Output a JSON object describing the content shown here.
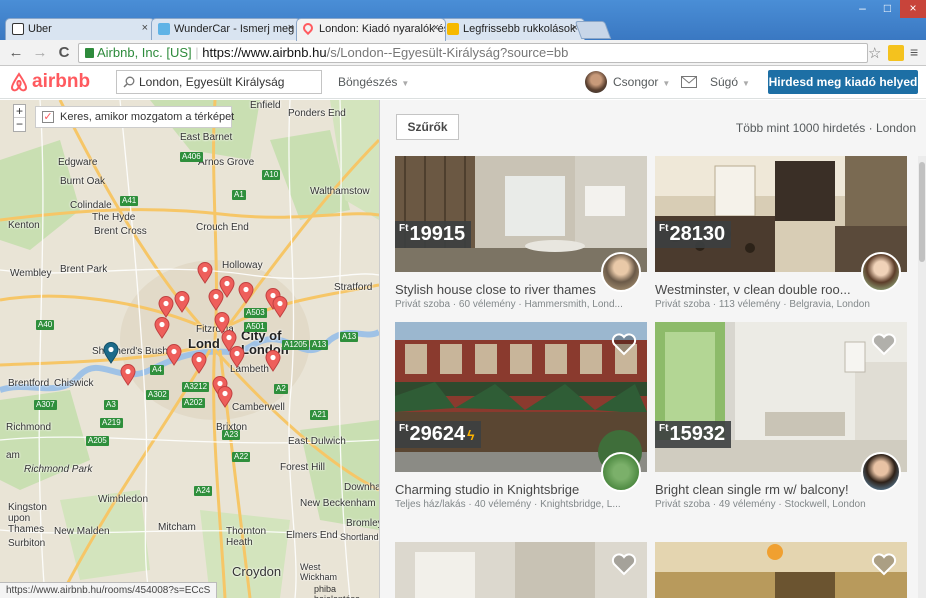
{
  "browser": {
    "tabs": [
      {
        "label": "Uber"
      },
      {
        "label": "WunderCar - Ismerj meg ú"
      },
      {
        "label": "London: Kiadó nyaralók és"
      },
      {
        "label": "Legfrissebb rukkolások | r"
      }
    ],
    "ev_label": "Airbnb, Inc. [US]",
    "url_host": "https://www.airbnb.hu",
    "url_rest": "/s/London--Egyesült-Királyság?source=bb",
    "status_url": "https://www.airbnb.hu/rooms/454008?s=ECcS",
    "icons": [
      "back-icon",
      "forward-icon",
      "reload-icon",
      "lock-icon",
      "star-icon",
      "menu-icon"
    ]
  },
  "header": {
    "logo_text": "airbnb",
    "search_value": "London, Egyesült Királyság",
    "browse_label": "Böngészés",
    "user_name": "Csongor",
    "help_label": "Súgó",
    "host_button": "Hirdesd meg kiadó helyed",
    "brand_color": "#ff5a5f",
    "button_color": "#1d6fa5"
  },
  "map": {
    "checkbox_label": "Keres, amikor mozgatom a térképet",
    "checkbox_checked": true,
    "zoom_in": "+",
    "zoom_out": "−",
    "data_label": "phiba bejelentése",
    "places": [
      "Enfield",
      "Ponders End",
      "East Barnet",
      "Edgware",
      "Burnt Oak",
      "Arnos Grove",
      "Colindale",
      "The Hyde",
      "Walthamstow",
      "Kenton",
      "Brent Cross",
      "Crouch End",
      "Wembley",
      "Brent Park",
      "Holloway",
      "Stratford",
      "City of",
      "London",
      "Fitzrovia",
      "Shepherd's Bush",
      "Chiswick",
      "Lambeth",
      "Camberwell",
      "Brentford",
      "Richmond",
      "Richmond Park",
      "Brixton",
      "East Dulwich",
      "Forest Hill",
      "Wimbledon",
      "Downham",
      "New Beckenham",
      "Kingston upon Thames",
      "New Malden",
      "Mitcham",
      "Thornton Heath",
      "Elmers End",
      "Bromley",
      "Shortlands",
      "Surbiton",
      "Croydon",
      "West Wickham",
      "Lond",
      "am"
    ],
    "roads": [
      "A406",
      "A41",
      "A1",
      "A10",
      "A503",
      "A501",
      "A40",
      "A4",
      "A3",
      "A23",
      "A205",
      "A22",
      "A24",
      "A21",
      "A13",
      "A13",
      "A307",
      "A2",
      "A302",
      "A3212",
      "A202",
      "A219",
      "A1205"
    ]
  },
  "listings_header": {
    "filters_label": "Szűrők",
    "count_label": "Több mint 1000 hirdetés · London"
  },
  "listings": [
    {
      "currency": "Ft",
      "price": "19915",
      "instant": false,
      "title": "Stylish house close to river thames",
      "subtitle": "Privát szoba · 60 vélemény · Hammersmith, Lond..."
    },
    {
      "currency": "Ft",
      "price": "28130",
      "instant": false,
      "title": "Westminster, v clean double roo...",
      "subtitle": "Privát szoba · 113 vélemény · Belgravia, London"
    },
    {
      "currency": "Ft",
      "price": "29624",
      "instant": true,
      "title": "Charming studio in Knightsbrige",
      "subtitle": "Teljes ház/lakás · 40 vélemény · Knightsbridge, L..."
    },
    {
      "currency": "Ft",
      "price": "15932",
      "instant": false,
      "title": "Bright clean single rm w/ balcony!",
      "subtitle": "Privát szoba · 49 vélemény · Stockwell, London"
    }
  ]
}
